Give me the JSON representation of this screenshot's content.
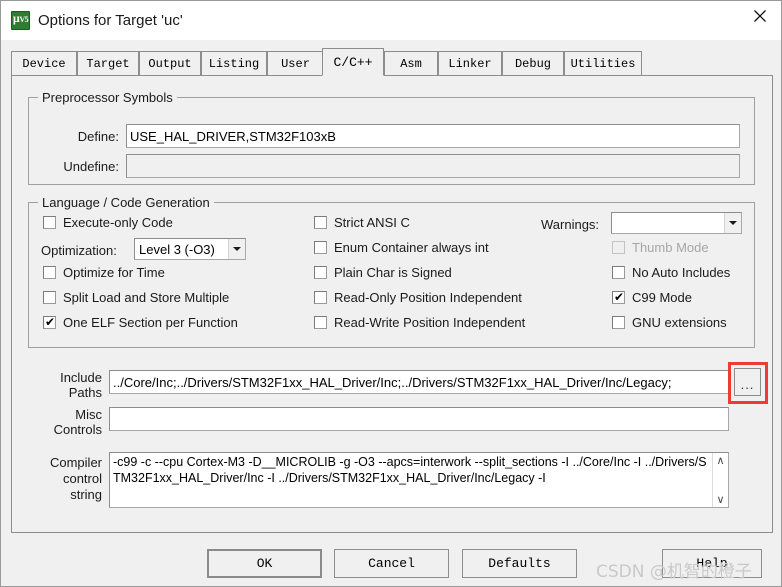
{
  "window": {
    "title": "Options for Target 'uc'",
    "icon": "uvision-icon",
    "close_label": "✕"
  },
  "tabs": [
    {
      "label": "Device",
      "active": false
    },
    {
      "label": "Target",
      "active": false
    },
    {
      "label": "Output",
      "active": false
    },
    {
      "label": "Listing",
      "active": false
    },
    {
      "label": "User",
      "active": false
    },
    {
      "label": "C/C++",
      "active": true
    },
    {
      "label": "Asm",
      "active": false
    },
    {
      "label": "Linker",
      "active": false
    },
    {
      "label": "Debug",
      "active": false
    },
    {
      "label": "Utilities",
      "active": false
    }
  ],
  "preprocessor": {
    "legend": "Preprocessor Symbols",
    "define_label": "Define:",
    "define_value": "USE_HAL_DRIVER,STM32F103xB",
    "undefine_label": "Undefine:",
    "undefine_value": ""
  },
  "language": {
    "legend": "Language / Code Generation",
    "col1": [
      {
        "label": "Execute-only Code",
        "checked": false,
        "disabled": false
      },
      {
        "label": "Optimize for Time",
        "checked": false,
        "disabled": false
      },
      {
        "label": "Split Load and Store Multiple",
        "checked": false,
        "disabled": false
      },
      {
        "label": "One ELF Section per Function",
        "checked": true,
        "disabled": false
      }
    ],
    "optimization_label": "Optimization:",
    "optimization_value": "Level 3 (-O3)",
    "col2": [
      {
        "label": "Strict ANSI C",
        "checked": false,
        "disabled": false
      },
      {
        "label": "Enum Container always int",
        "checked": false,
        "disabled": false
      },
      {
        "label": "Plain Char is Signed",
        "checked": false,
        "disabled": false
      },
      {
        "label": "Read-Only Position Independent",
        "checked": false,
        "disabled": false
      },
      {
        "label": "Read-Write Position Independent",
        "checked": false,
        "disabled": false
      }
    ],
    "warnings_label": "Warnings:",
    "warnings_value": "",
    "col3": [
      {
        "label": "Thumb Mode",
        "checked": false,
        "disabled": true
      },
      {
        "label": "No Auto Includes",
        "checked": false,
        "disabled": false
      },
      {
        "label": "C99 Mode",
        "checked": true,
        "disabled": false
      },
      {
        "label": "GNU extensions",
        "checked": false,
        "disabled": false
      }
    ]
  },
  "paths": {
    "include_label_line1": "Include",
    "include_label_line2": "Paths",
    "include_value": "../Core/Inc;../Drivers/STM32F1xx_HAL_Driver/Inc;../Drivers/STM32F1xx_HAL_Driver/Inc/Legacy;",
    "browse_label": "...",
    "misc_label_line1": "Misc",
    "misc_label_line2": "Controls",
    "misc_value": ""
  },
  "compiler": {
    "label_line1": "Compiler",
    "label_line2": "control",
    "label_line3": "string",
    "value": "-c99 -c --cpu Cortex-M3 -D__MICROLIB -g -O3 --apcs=interwork --split_sections -I ../Core/Inc -I ../Drivers/STM32F1xx_HAL_Driver/Inc -I ../Drivers/STM32F1xx_HAL_Driver/Inc/Legacy -I",
    "scroll_up": "∧",
    "scroll_down": "∨"
  },
  "buttons": {
    "ok": "OK",
    "cancel": "Cancel",
    "defaults": "Defaults",
    "help": "Help"
  },
  "watermark": {
    "text": "CSDN @机智的橙子"
  },
  "colors": {
    "highlight": "#ee3b33",
    "dialog_bg": "#f0f0f0",
    "accent_green": "#2f7d32"
  }
}
